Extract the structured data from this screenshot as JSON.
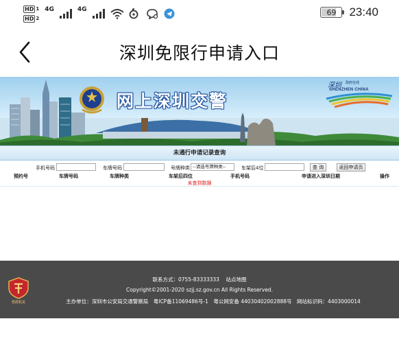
{
  "status_bar": {
    "hd1": "HD",
    "hd1_sub": "1",
    "hd2": "HD",
    "hd2_sub": "2",
    "net1": "4G",
    "net2": "4G",
    "battery_level": "69",
    "time": "23:40",
    "icons": [
      "wifi-icon",
      "nfc-icon",
      "chat-icon",
      "telegram-icon"
    ]
  },
  "title_bar": {
    "title": "深圳免限行申请入口",
    "back_icon": "chevron-left-icon"
  },
  "banner": {
    "title": "网上深圳交警",
    "logo_cn": "深圳",
    "logo_gov": "政府在线",
    "logo_en": "SHENZHEN CHINA"
  },
  "section": {
    "title": "未通行申请记录查询"
  },
  "filters": {
    "phone_label": "手机号码",
    "plate_label": "车牌号码",
    "plate_type_label": "号牌种类",
    "plate_type_select": "--请选号牌种类--",
    "vin_label": "车架后4位",
    "query_button": "查 询",
    "back_button": "返回申请页"
  },
  "table": {
    "headers": [
      "预约号",
      "车牌号码",
      "车牌种类",
      "车架后四位",
      "手机号码",
      "申请进入深圳日期",
      "操作"
    ],
    "empty_text": "未查到数据"
  },
  "footer": {
    "contact": "联系方式：0755-83333333",
    "sitemap": "站点地图",
    "copyright": "Copyright©2001-2020 szjj.sz.gov.cn All Rights Reserved.",
    "host": "主办单位：深圳市公安局交通警察局　粤ICP备11069486号-1　粤公网安备 44030402002888号　网站标识码：4403000014",
    "badge_caption": "党政机关"
  },
  "colors": {
    "banner_title_stroke": "#1d4f9c",
    "section_bg": "#cfe6f5",
    "no_data": "#e02020",
    "footer_bg": "#4a4a4a"
  }
}
